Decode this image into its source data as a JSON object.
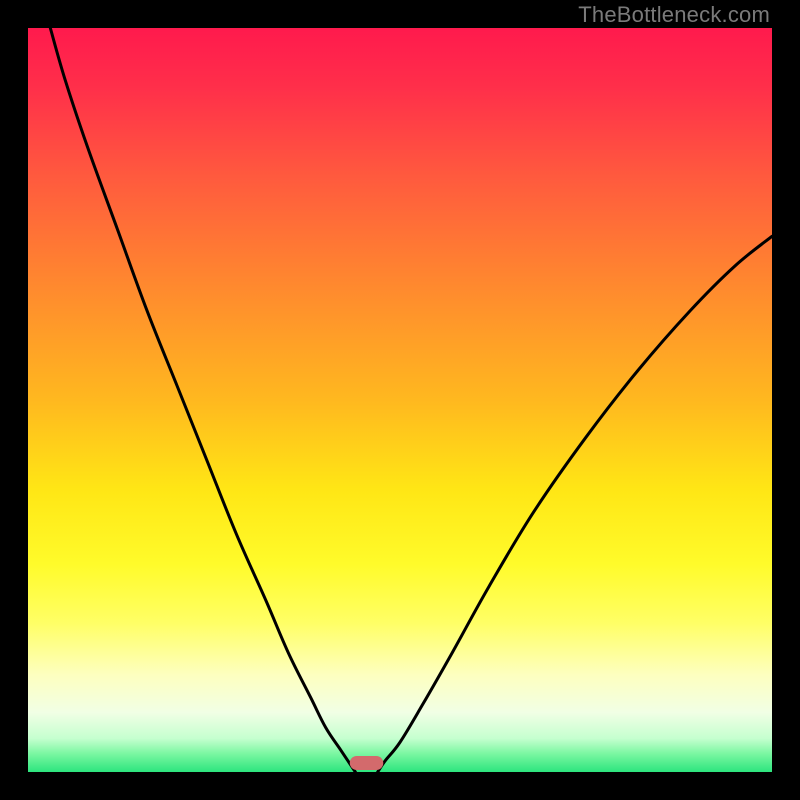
{
  "watermark": "TheBottleneck.com",
  "chart_data": {
    "type": "line",
    "title": "",
    "xlabel": "",
    "ylabel": "",
    "xlim": [
      0,
      1
    ],
    "ylim": [
      0,
      1
    ],
    "series": [
      {
        "name": "left-curve",
        "x": [
          0.03,
          0.05,
          0.08,
          0.12,
          0.16,
          0.2,
          0.24,
          0.28,
          0.32,
          0.35,
          0.38,
          0.4,
          0.42,
          0.43,
          0.44
        ],
        "y": [
          1.0,
          0.93,
          0.84,
          0.73,
          0.62,
          0.52,
          0.42,
          0.32,
          0.23,
          0.16,
          0.1,
          0.06,
          0.03,
          0.015,
          0.0
        ]
      },
      {
        "name": "right-curve",
        "x": [
          0.47,
          0.48,
          0.5,
          0.53,
          0.57,
          0.62,
          0.68,
          0.75,
          0.82,
          0.89,
          0.95,
          1.0
        ],
        "y": [
          0.0,
          0.015,
          0.04,
          0.09,
          0.16,
          0.25,
          0.35,
          0.45,
          0.54,
          0.62,
          0.68,
          0.72
        ]
      }
    ],
    "marker": {
      "name": "bottleneck-marker",
      "x": 0.455,
      "width": 0.045,
      "color": "#d36a6c"
    },
    "gradient_stops": [
      {
        "offset": 0.0,
        "color": "#ff1a4d"
      },
      {
        "offset": 0.08,
        "color": "#ff2f4a"
      },
      {
        "offset": 0.2,
        "color": "#ff5a3e"
      },
      {
        "offset": 0.35,
        "color": "#ff8a2e"
      },
      {
        "offset": 0.5,
        "color": "#ffb81f"
      },
      {
        "offset": 0.62,
        "color": "#ffe615"
      },
      {
        "offset": 0.72,
        "color": "#fffb2a"
      },
      {
        "offset": 0.8,
        "color": "#ffff66"
      },
      {
        "offset": 0.87,
        "color": "#fdffc0"
      },
      {
        "offset": 0.92,
        "color": "#f1ffe5"
      },
      {
        "offset": 0.955,
        "color": "#c5ffcf"
      },
      {
        "offset": 0.975,
        "color": "#7cf7a2"
      },
      {
        "offset": 1.0,
        "color": "#2de57e"
      }
    ]
  }
}
